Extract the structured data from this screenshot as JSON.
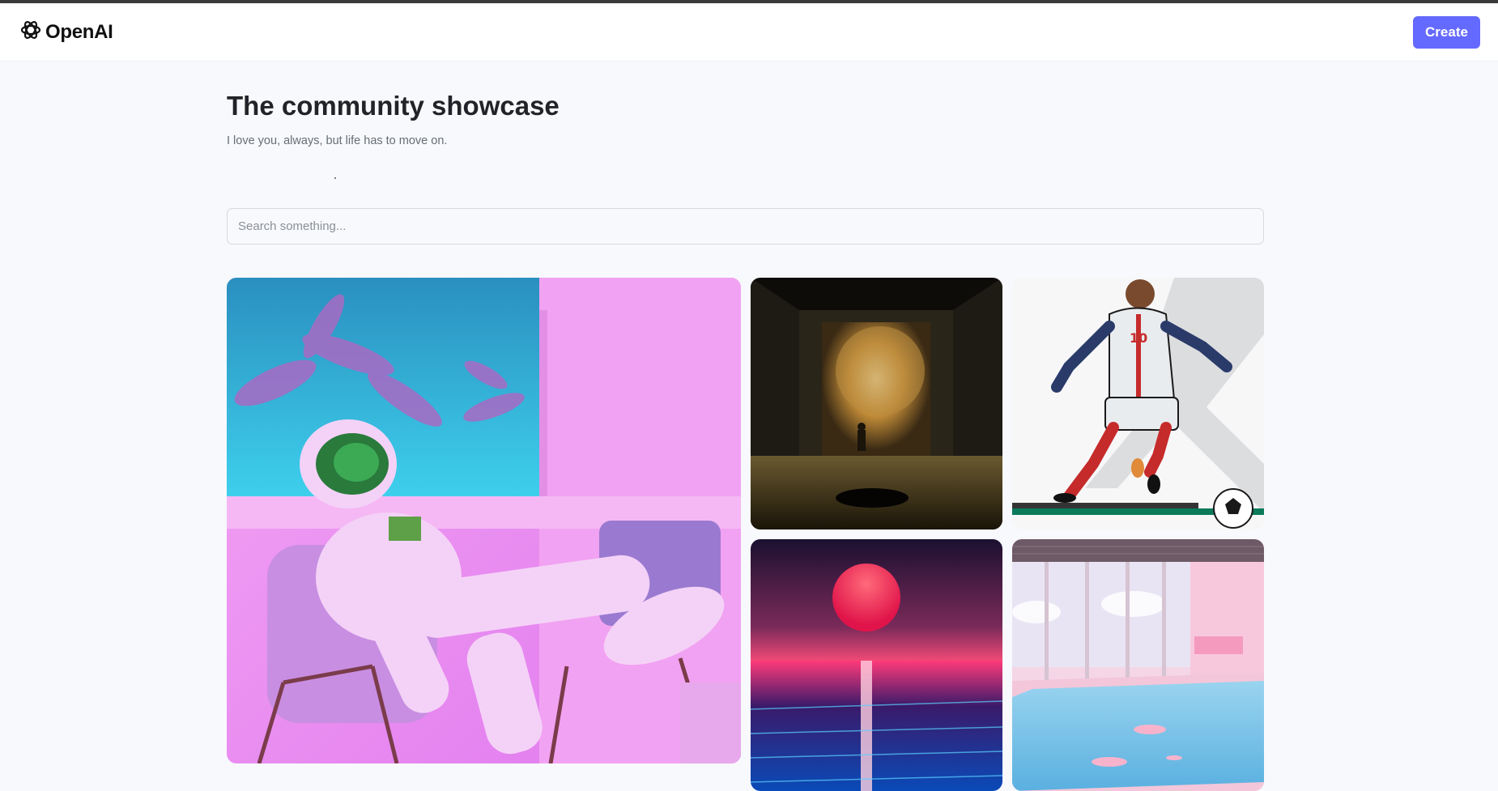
{
  "header": {
    "logo_text": "OpenAI",
    "create_label": "Create"
  },
  "main": {
    "title": "The community showcase",
    "subtitle": "I love you, always, but life has to move on."
  },
  "search": {
    "placeholder": "Search something..."
  },
  "colors": {
    "accent": "#6469ff",
    "page_bg": "#f8f9fc",
    "title": "#222328",
    "subtitle": "#666e75"
  },
  "icons": [
    "openai-logo-icon"
  ],
  "gallery": {
    "images": [
      "astronaut-lounging-pink-room",
      "portal-doorway-planet",
      "soccer-player-illustration",
      "synthwave-sunset-ocean",
      "pink-indoor-pool"
    ]
  }
}
